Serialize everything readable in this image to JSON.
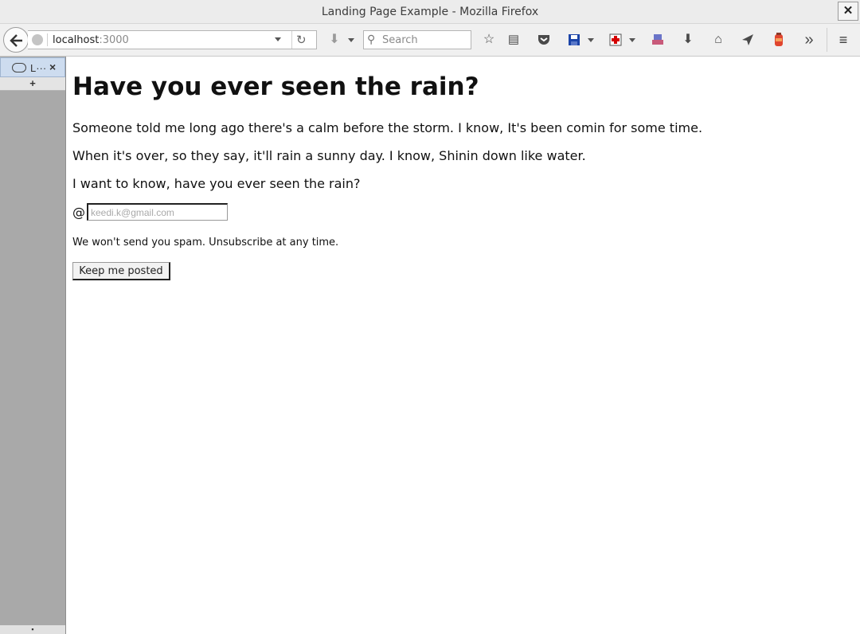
{
  "window": {
    "title": "Landing Page Example - Mozilla Firefox",
    "close_glyph": "✕"
  },
  "toolbar": {
    "url_host": "localhost",
    "url_port": ":3000",
    "search_placeholder": "Search",
    "overflow_glyph": "»"
  },
  "sidebar": {
    "tab_label": "L···",
    "tab_close": "×",
    "new_tab": "+",
    "bottom_glyph": "▪"
  },
  "page": {
    "heading": "Have you ever seen the rain?",
    "paragraphs": [
      "Someone told me long ago there's a calm before the storm. I know, It's been comin for some time.",
      "When it's over, so they say, it'll rain a sunny day. I know, Shinin down like water.",
      "I want to know, have you ever seen the rain?"
    ],
    "at_symbol": "@",
    "email_placeholder": "keedi.k@gmail.com",
    "note": "We won't send you spam. Unsubscribe at any time.",
    "button_label": "Keep me posted"
  }
}
